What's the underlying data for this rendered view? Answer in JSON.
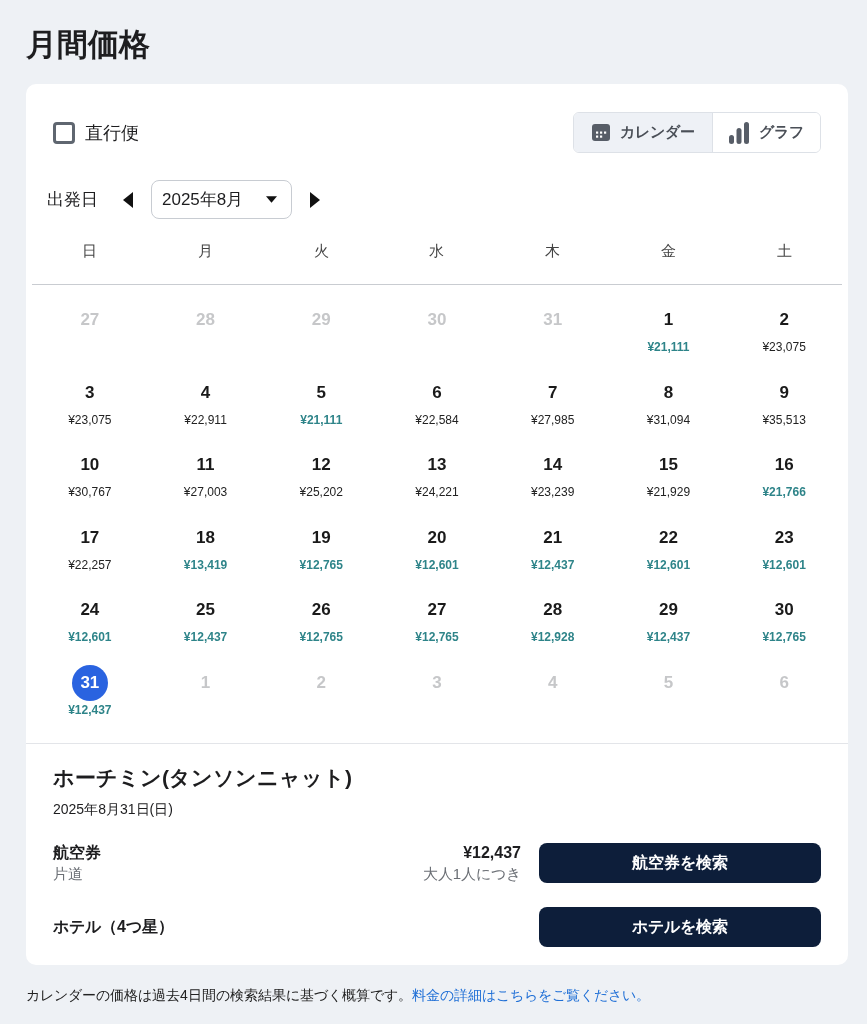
{
  "page": {
    "title": "月間価格"
  },
  "filters": {
    "nonstop": {
      "label": "直行便",
      "checked": false
    }
  },
  "view_toggle": [
    {
      "label": "カレンダー",
      "kind": "calendar",
      "selected": true
    },
    {
      "label": "グラフ",
      "kind": "chart",
      "selected": false
    }
  ],
  "month_picker": {
    "label": "出発日",
    "value": "2025年8月"
  },
  "calendar": {
    "weekdays": [
      "日",
      "月",
      "火",
      "水",
      "木",
      "金",
      "土"
    ],
    "weeks": [
      [
        {
          "day": "27",
          "in_month": false,
          "selected": false
        },
        {
          "day": "28",
          "in_month": false,
          "selected": false
        },
        {
          "day": "29",
          "in_month": false,
          "selected": false
        },
        {
          "day": "30",
          "in_month": false,
          "selected": false
        },
        {
          "day": "31",
          "in_month": false,
          "selected": false
        },
        {
          "day": "1",
          "in_month": true,
          "price": "¥21,111",
          "cheap": true,
          "selected": false
        },
        {
          "day": "2",
          "in_month": true,
          "price": "¥23,075",
          "cheap": false,
          "selected": false
        }
      ],
      [
        {
          "day": "3",
          "in_month": true,
          "price": "¥23,075",
          "cheap": false,
          "selected": false
        },
        {
          "day": "4",
          "in_month": true,
          "price": "¥22,911",
          "cheap": false,
          "selected": false
        },
        {
          "day": "5",
          "in_month": true,
          "price": "¥21,111",
          "cheap": true,
          "selected": false
        },
        {
          "day": "6",
          "in_month": true,
          "price": "¥22,584",
          "cheap": false,
          "selected": false
        },
        {
          "day": "7",
          "in_month": true,
          "price": "¥27,985",
          "cheap": false,
          "selected": false
        },
        {
          "day": "8",
          "in_month": true,
          "price": "¥31,094",
          "cheap": false,
          "selected": false
        },
        {
          "day": "9",
          "in_month": true,
          "price": "¥35,513",
          "cheap": false,
          "selected": false
        }
      ],
      [
        {
          "day": "10",
          "in_month": true,
          "price": "¥30,767",
          "cheap": false,
          "selected": false
        },
        {
          "day": "11",
          "in_month": true,
          "price": "¥27,003",
          "cheap": false,
          "selected": false
        },
        {
          "day": "12",
          "in_month": true,
          "price": "¥25,202",
          "cheap": false,
          "selected": false
        },
        {
          "day": "13",
          "in_month": true,
          "price": "¥24,221",
          "cheap": false,
          "selected": false
        },
        {
          "day": "14",
          "in_month": true,
          "price": "¥23,239",
          "cheap": false,
          "selected": false
        },
        {
          "day": "15",
          "in_month": true,
          "price": "¥21,929",
          "cheap": false,
          "selected": false
        },
        {
          "day": "16",
          "in_month": true,
          "price": "¥21,766",
          "cheap": true,
          "selected": false
        }
      ],
      [
        {
          "day": "17",
          "in_month": true,
          "price": "¥22,257",
          "cheap": false,
          "selected": false
        },
        {
          "day": "18",
          "in_month": true,
          "price": "¥13,419",
          "cheap": true,
          "selected": false
        },
        {
          "day": "19",
          "in_month": true,
          "price": "¥12,765",
          "cheap": true,
          "selected": false
        },
        {
          "day": "20",
          "in_month": true,
          "price": "¥12,601",
          "cheap": true,
          "selected": false
        },
        {
          "day": "21",
          "in_month": true,
          "price": "¥12,437",
          "cheap": true,
          "selected": false
        },
        {
          "day": "22",
          "in_month": true,
          "price": "¥12,601",
          "cheap": true,
          "selected": false
        },
        {
          "day": "23",
          "in_month": true,
          "price": "¥12,601",
          "cheap": true,
          "selected": false
        }
      ],
      [
        {
          "day": "24",
          "in_month": true,
          "price": "¥12,601",
          "cheap": true,
          "selected": false
        },
        {
          "day": "25",
          "in_month": true,
          "price": "¥12,437",
          "cheap": true,
          "selected": false
        },
        {
          "day": "26",
          "in_month": true,
          "price": "¥12,765",
          "cheap": true,
          "selected": false
        },
        {
          "day": "27",
          "in_month": true,
          "price": "¥12,765",
          "cheap": true,
          "selected": false
        },
        {
          "day": "28",
          "in_month": true,
          "price": "¥12,928",
          "cheap": true,
          "selected": false
        },
        {
          "day": "29",
          "in_month": true,
          "price": "¥12,437",
          "cheap": true,
          "selected": false
        },
        {
          "day": "30",
          "in_month": true,
          "price": "¥12,765",
          "cheap": true,
          "selected": false
        }
      ],
      [
        {
          "day": "31",
          "in_month": true,
          "price": "¥12,437",
          "cheap": true,
          "selected": true
        },
        {
          "day": "1",
          "in_month": false,
          "selected": false
        },
        {
          "day": "2",
          "in_month": false,
          "selected": false
        },
        {
          "day": "3",
          "in_month": false,
          "selected": false
        },
        {
          "day": "4",
          "in_month": false,
          "selected": false
        },
        {
          "day": "5",
          "in_month": false,
          "selected": false
        },
        {
          "day": "6",
          "in_month": false,
          "selected": false
        }
      ]
    ]
  },
  "summary": {
    "title": "ホーチミン(タンソンニャット)",
    "date": "2025年8月31日(日)",
    "offers": [
      {
        "label": "航空券",
        "sublabel": "片道",
        "price": "¥12,437",
        "price_note": "大人1人につき",
        "button": "航空券を検索"
      },
      {
        "label": "ホテル（4つ星）",
        "button": "ホテルを検索"
      }
    ]
  },
  "footer": {
    "text": "カレンダーの価格は過去4日間の検索結果に基づく概算です。",
    "link": "料金の詳細はこちらをご覧ください。"
  }
}
